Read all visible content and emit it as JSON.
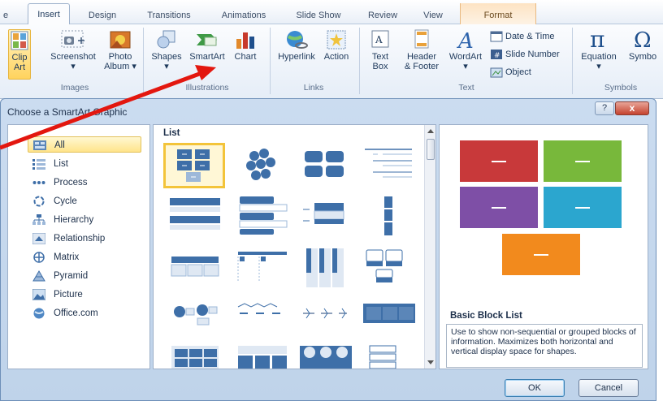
{
  "ribbon": {
    "tabs": [
      {
        "label": "e",
        "active": false
      },
      {
        "label": "Insert",
        "active": true
      },
      {
        "label": "Design",
        "active": false
      },
      {
        "label": "Transitions",
        "active": false
      },
      {
        "label": "Animations",
        "active": false
      },
      {
        "label": "Slide Show",
        "active": false
      },
      {
        "label": "Review",
        "active": false
      },
      {
        "label": "View",
        "active": false
      },
      {
        "label": "Format",
        "active": false,
        "contextual": true
      }
    ],
    "groups": {
      "images": {
        "label": "Images",
        "buttons": [
          {
            "line1": "Clip",
            "line2": "Art",
            "icon": "clip-art-icon",
            "selected": true
          },
          {
            "line1": "Screenshot",
            "line2": "▾",
            "icon": "screenshot-icon"
          },
          {
            "line1": "Photo",
            "line2": "Album ▾",
            "icon": "photo-album-icon"
          }
        ]
      },
      "illustrations": {
        "label": "Illustrations",
        "buttons": [
          {
            "line1": "Shapes",
            "line2": "▾",
            "icon": "shapes-icon"
          },
          {
            "line1": "SmartArt",
            "line2": "",
            "icon": "smartart-icon"
          },
          {
            "line1": "Chart",
            "line2": "",
            "icon": "chart-icon"
          }
        ]
      },
      "links": {
        "label": "Links",
        "buttons": [
          {
            "line1": "Hyperlink",
            "line2": "",
            "icon": "hyperlink-icon"
          },
          {
            "line1": "Action",
            "line2": "",
            "icon": "action-icon"
          }
        ]
      },
      "text": {
        "label": "Text",
        "buttons": [
          {
            "line1": "Text",
            "line2": "Box",
            "icon": "text-box-icon"
          },
          {
            "line1": "Header",
            "line2": "& Footer",
            "icon": "header-footer-icon"
          },
          {
            "line1": "WordArt",
            "line2": "▾",
            "icon": "wordart-icon"
          }
        ],
        "small_buttons": [
          {
            "label": "Date & Time",
            "icon": "date-time-icon"
          },
          {
            "label": "Slide Number",
            "icon": "slide-number-icon"
          },
          {
            "label": "Object",
            "icon": "object-icon"
          }
        ]
      },
      "symbols": {
        "label": "Symbols",
        "buttons": [
          {
            "line1": "Equation",
            "line2": "▾",
            "icon": "pi-icon"
          },
          {
            "line1": "Symbo",
            "line2": "",
            "icon": "omega-icon"
          }
        ]
      }
    }
  },
  "dialog": {
    "title": "Choose a SmartArt Graphic",
    "help_label": "?",
    "close_label": "x",
    "categories": [
      {
        "label": "All",
        "icon": "all-icon",
        "selected": true
      },
      {
        "label": "List",
        "icon": "list-icon"
      },
      {
        "label": "Process",
        "icon": "process-icon"
      },
      {
        "label": "Cycle",
        "icon": "cycle-icon"
      },
      {
        "label": "Hierarchy",
        "icon": "hierarchy-icon"
      },
      {
        "label": "Relationship",
        "icon": "relationship-icon"
      },
      {
        "label": "Matrix",
        "icon": "matrix-icon"
      },
      {
        "label": "Pyramid",
        "icon": "pyramid-icon"
      },
      {
        "label": "Picture",
        "icon": "picture-icon"
      },
      {
        "label": "Office.com",
        "icon": "office-com-icon"
      }
    ],
    "gallery_heading": "List",
    "preview": {
      "title": "Basic Block List",
      "description": "Use to show non-sequential or grouped blocks of information. Maximizes both horizontal and vertical display space for shapes.",
      "colors": [
        "#c8393a",
        "#78b83b",
        "#7e4fa6",
        "#2ba6cf",
        "#f28a1d"
      ]
    },
    "ok_label": "OK",
    "cancel_label": "Cancel"
  },
  "colors": {
    "accent_blue": "#3e6fa8",
    "light_blue": "#9db8d9",
    "selection_yellow": "#f3c43a",
    "annotation_arrow": "#e3170f"
  }
}
